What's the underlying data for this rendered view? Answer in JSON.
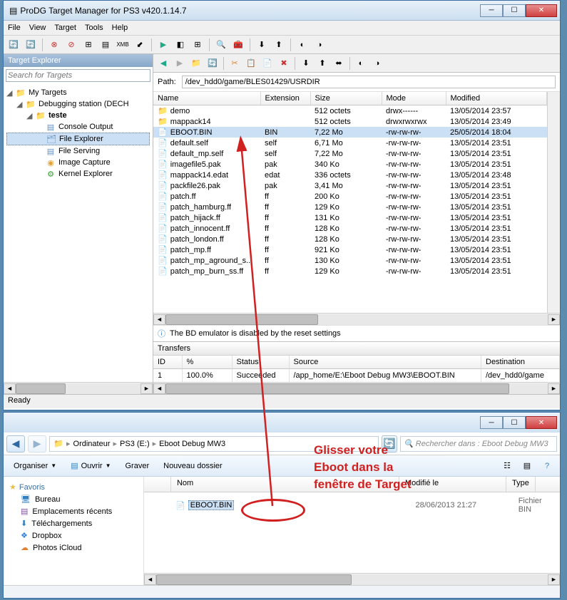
{
  "app": {
    "title": "ProDG Target Manager for PS3 v420.1.14.7",
    "menu": [
      "File",
      "View",
      "Target",
      "Tools",
      "Help"
    ],
    "status": "Ready"
  },
  "target_explorer": {
    "title": "Target Explorer",
    "search_placeholder": "Search for Targets",
    "tree": {
      "root": "My Targets",
      "station": "Debugging station (DECH",
      "teste": "teste",
      "items": [
        "Console Output",
        "File Explorer",
        "File Serving",
        "Image Capture",
        "Kernel Explorer"
      ]
    }
  },
  "file_browser": {
    "path_label": "Path:",
    "path": "/dev_hdd0/game/BLES01429/USRDIR",
    "columns": [
      "Name",
      "Extension",
      "Size",
      "Mode",
      "Modified"
    ],
    "rows": [
      {
        "icon": "folder",
        "name": "demo",
        "ext": "",
        "size": "512 octets",
        "mode": "drwx------",
        "mod": "13/05/2014 23:57"
      },
      {
        "icon": "folder",
        "name": "mappack14",
        "ext": "",
        "size": "512 octets",
        "mode": "drwxrwxrwx",
        "mod": "13/05/2014 23:49"
      },
      {
        "icon": "file",
        "name": "EBOOT.BIN",
        "ext": "BIN",
        "size": "7,22 Mo",
        "mode": "-rw-rw-rw-",
        "mod": "25/05/2014 18:04",
        "sel": true
      },
      {
        "icon": "file",
        "name": "default.self",
        "ext": "self",
        "size": "6,71 Mo",
        "mode": "-rw-rw-rw-",
        "mod": "13/05/2014 23:51"
      },
      {
        "icon": "file",
        "name": "default_mp.self",
        "ext": "self",
        "size": "7,22 Mo",
        "mode": "-rw-rw-rw-",
        "mod": "13/05/2014 23:51"
      },
      {
        "icon": "file",
        "name": "imagefile5.pak",
        "ext": "pak",
        "size": "340 Ko",
        "mode": "-rw-rw-rw-",
        "mod": "13/05/2014 23:51"
      },
      {
        "icon": "file",
        "name": "mappack14.edat",
        "ext": "edat",
        "size": "336 octets",
        "mode": "-rw-rw-rw-",
        "mod": "13/05/2014 23:48"
      },
      {
        "icon": "file",
        "name": "packfile26.pak",
        "ext": "pak",
        "size": "3,41 Mo",
        "mode": "-rw-rw-rw-",
        "mod": "13/05/2014 23:51"
      },
      {
        "icon": "file",
        "name": "patch.ff",
        "ext": "ff",
        "size": "200 Ko",
        "mode": "-rw-rw-rw-",
        "mod": "13/05/2014 23:51"
      },
      {
        "icon": "file",
        "name": "patch_hamburg.ff",
        "ext": "ff",
        "size": "129 Ko",
        "mode": "-rw-rw-rw-",
        "mod": "13/05/2014 23:51"
      },
      {
        "icon": "file",
        "name": "patch_hijack.ff",
        "ext": "ff",
        "size": "131 Ko",
        "mode": "-rw-rw-rw-",
        "mod": "13/05/2014 23:51"
      },
      {
        "icon": "file",
        "name": "patch_innocent.ff",
        "ext": "ff",
        "size": "128 Ko",
        "mode": "-rw-rw-rw-",
        "mod": "13/05/2014 23:51"
      },
      {
        "icon": "file",
        "name": "patch_london.ff",
        "ext": "ff",
        "size": "128 Ko",
        "mode": "-rw-rw-rw-",
        "mod": "13/05/2014 23:51"
      },
      {
        "icon": "file",
        "name": "patch_mp.ff",
        "ext": "ff",
        "size": "921 Ko",
        "mode": "-rw-rw-rw-",
        "mod": "13/05/2014 23:51"
      },
      {
        "icon": "file",
        "name": "patch_mp_aground_s..",
        "ext": "ff",
        "size": "130 Ko",
        "mode": "-rw-rw-rw-",
        "mod": "13/05/2014 23:51"
      },
      {
        "icon": "file",
        "name": "patch_mp_burn_ss.ff",
        "ext": "ff",
        "size": "129 Ko",
        "mode": "-rw-rw-rw-",
        "mod": "13/05/2014 23:51"
      }
    ],
    "status_text": "The BD emulator is disabled by the reset settings"
  },
  "transfers": {
    "title": "Transfers",
    "columns": [
      "ID",
      "%",
      "Status",
      "Source",
      "Destination"
    ],
    "row": {
      "id": "1",
      "pct": "100.0%",
      "status": "Succeeded",
      "src": "/app_home/E:\\Eboot Debug MW3\\EBOOT.BIN",
      "dst": "/dev_hdd0/game"
    }
  },
  "explorer": {
    "breadcrumb": [
      "Ordinateur",
      "PS3 (E:)",
      "Eboot Debug MW3"
    ],
    "search_placeholder": "Rechercher dans : Eboot Debug MW3",
    "toolbar": {
      "organize": "Organiser",
      "open": "Ouvrir",
      "burn": "Graver",
      "newfolder": "Nouveau dossier"
    },
    "columns": {
      "name": "Nom",
      "modified": "Modifié le",
      "type": "Type"
    },
    "favorites": {
      "head": "Favoris",
      "items": [
        "Bureau",
        "Emplacements récents",
        "Téléchargements",
        "Dropbox",
        "Photos iCloud"
      ]
    },
    "file": {
      "name": "EBOOT.BIN",
      "date": "28/06/2013 21:27",
      "type": "Fichier BIN"
    }
  },
  "annotation": {
    "line1": "Glisser votre",
    "line2": "Eboot dans la",
    "line3": "fenêtre de Target"
  }
}
